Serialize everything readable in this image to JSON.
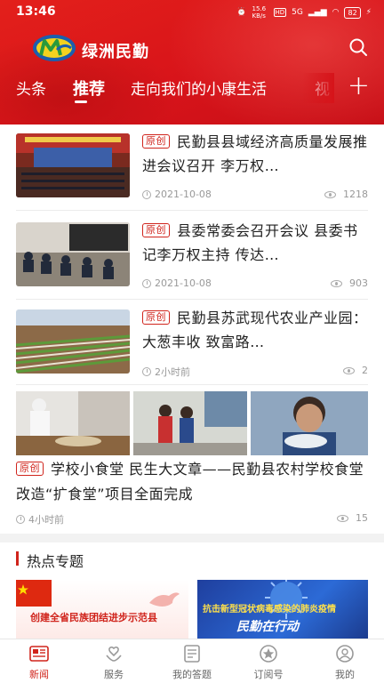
{
  "statusbar": {
    "time": "13:46",
    "network": "15.6 KB/s",
    "hd": "HD",
    "signal": "5G",
    "battery": "82"
  },
  "header": {
    "title": "绿洲民勤",
    "tabs": [
      "头条",
      "推荐",
      "走向我们的小康生活",
      "视"
    ]
  },
  "news": [
    {
      "tag": "原创",
      "title": "民勤县县域经济高质量发展推进会议召开 李万权…",
      "date": "2021-10-08",
      "views": "1218"
    },
    {
      "tag": "原创",
      "title": "县委常委会召开会议 县委书记李万权主持 传达…",
      "date": "2021-10-08",
      "views": "903"
    },
    {
      "tag": "原创",
      "title": "民勤县苏武现代农业产业园：大葱丰收 致富路…",
      "date": "2小时前",
      "views": "2"
    },
    {
      "tag": "原创",
      "title": "学校小食堂 民生大文章——民勤县农村学校食堂改造“扩食堂”项目全面完成",
      "date": "4小时前",
      "views": "15"
    }
  ],
  "hot": {
    "title": "热点专题",
    "banners": [
      {
        "text": "创建全省民族团结进步示范县"
      },
      {
        "text": "抗击新型冠状病毒感染的肺炎疫情",
        "subtext": "民勤在行动"
      }
    ]
  },
  "bottomnav": [
    "新闻",
    "服务",
    "我的答题",
    "订阅号",
    "我的"
  ],
  "colors": {
    "brand_red": "#d8141a",
    "accent": "#d0241c"
  }
}
